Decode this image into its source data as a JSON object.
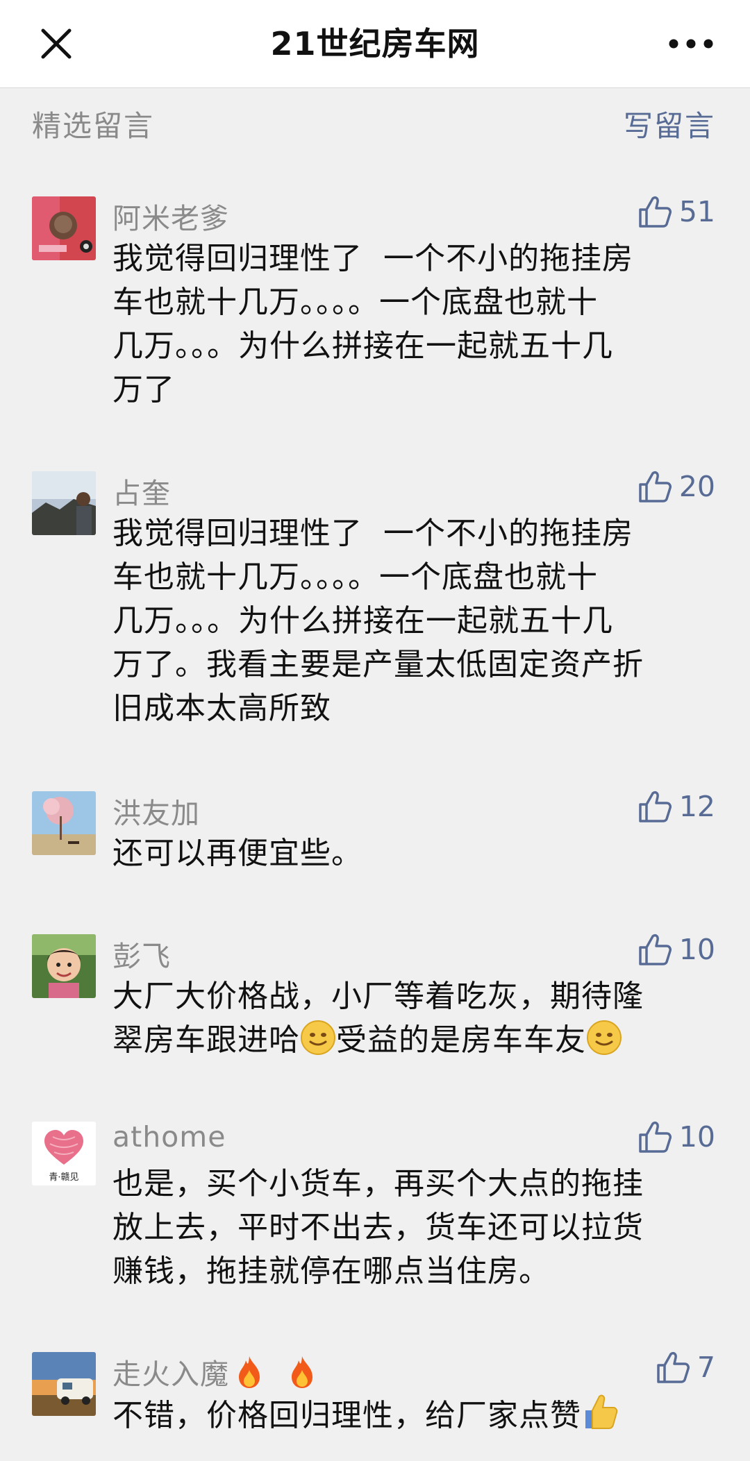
{
  "header": {
    "title": "21世纪房车网",
    "close_icon": "close-icon",
    "more_icon": "more-icon"
  },
  "section": {
    "label": "精选留言",
    "write": "写留言"
  },
  "comments": [
    {
      "name": "阿米老爹",
      "likes": "51",
      "lines": [
        "我觉得回归理性了  一个不小的拖挂房",
        "车也就十几万。。。。一个底盘也就十",
        "几万。。。为什么拼接在一起就五十几",
        "万了"
      ]
    },
    {
      "name": "占奎",
      "likes": "20",
      "lines": [
        "我觉得回归理性了  一个不小的拖挂房",
        "车也就十几万。。。。一个底盘也就十",
        "几万。。。为什么拼接在一起就五十几",
        "万了。我看主要是产量太低固定资产折",
        "旧成本太高所致"
      ]
    },
    {
      "name": "洪友加",
      "likes": "12",
      "lines": [
        "还可以再便宜些。"
      ]
    },
    {
      "name": "彭飞",
      "likes": "10",
      "line1": "大厂大价格战，小厂等着吃灰，期待隆",
      "line2a": "翠房车跟进哈",
      "line2b": "受益的是房车车友"
    },
    {
      "name": "athome",
      "likes": "10",
      "lines": [
        "也是，买个小货车，再买个大点的拖挂",
        "放上去，平时不出去，货车还可以拉货",
        "赚钱，拖挂就停在哪点当住房。"
      ],
      "avatar_text": "青·赣见"
    },
    {
      "name": "走火入魔",
      "likes": "7",
      "text": "不错，价格回归理性，给厂家点赞"
    }
  ]
}
